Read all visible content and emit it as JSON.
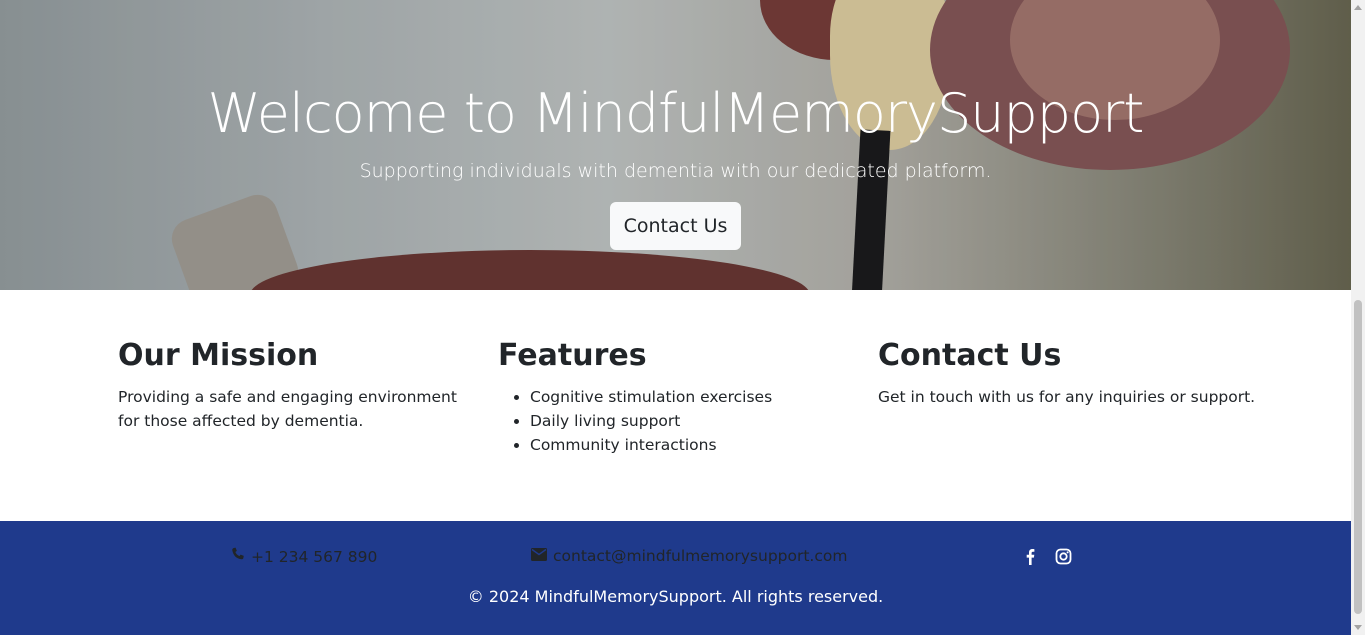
{
  "hero": {
    "title": "Welcome to MindfulMemorySupport",
    "subtitle": "Supporting individuals with dementia with our dedicated platform.",
    "cta_label": "Contact Us"
  },
  "sections": {
    "mission": {
      "heading": "Our Mission",
      "text": "Providing a safe and engaging environment for those affected by dementia."
    },
    "features": {
      "heading": "Features",
      "items": [
        "Cognitive stimulation exercises",
        "Daily living support",
        "Community interactions"
      ]
    },
    "contact": {
      "heading": "Contact Us",
      "text": "Get in touch with us for any inquiries or support."
    }
  },
  "footer": {
    "phone": "+1 234 567 890",
    "email": "contact@mindfulmemorysupport.com",
    "social": [
      "facebook-icon",
      "instagram-icon"
    ],
    "copyright": "© 2024 MindfulMemorySupport. All rights reserved."
  },
  "colors": {
    "footer_bg": "#1f3a8c",
    "text": "#212529"
  }
}
